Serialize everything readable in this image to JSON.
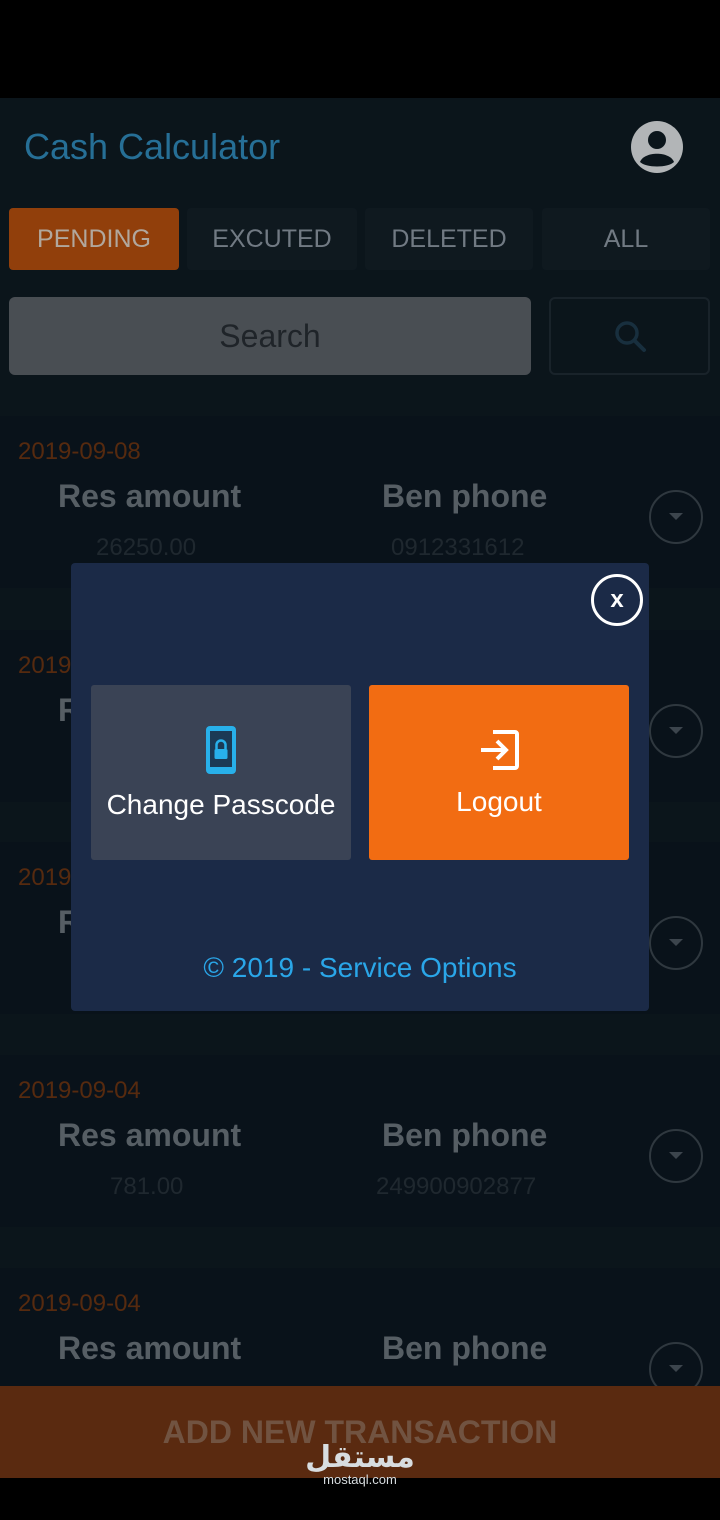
{
  "app": {
    "title": "Cash Calculator"
  },
  "colors": {
    "accent": "#f26c12",
    "title": "#2f88b8",
    "dialog_bg": "#1b2a47",
    "footer_link": "#2aa6e8"
  },
  "tabs": [
    {
      "label": "PENDING",
      "active": true
    },
    {
      "label": "EXCUTED",
      "active": false
    },
    {
      "label": "DELETED",
      "active": false
    },
    {
      "label": "ALL",
      "active": false
    }
  ],
  "search": {
    "placeholder": "Search",
    "button_icon": "search-icon"
  },
  "transactions": [
    {
      "date": "2019-09-08",
      "res_label": "Res amount",
      "res_value": "26250.00",
      "ben_label": "Ben phone",
      "ben_value": "0912331612"
    },
    {
      "date": "2019",
      "res_label": "R"
    },
    {
      "date": "2019",
      "res_label": "R"
    },
    {
      "date": "2019-09-04",
      "res_label": "Res amount",
      "res_value": "781.00",
      "ben_label": "Ben phone",
      "ben_value": "249900902877"
    },
    {
      "date": "2019-09-04",
      "res_label": "Res amount",
      "ben_label": "Ben phone"
    }
  ],
  "add_button": {
    "label": "ADD NEW TRANSACTION"
  },
  "dialog": {
    "close_label": "x",
    "change_passcode": {
      "label": "Change Passcode",
      "icon": "phone-lock-icon"
    },
    "logout": {
      "label": "Logout",
      "icon": "logout-icon"
    },
    "footer": "© 2019 - Service Options"
  },
  "watermark": {
    "main": "مستقل",
    "sub": "mostaql.com"
  }
}
